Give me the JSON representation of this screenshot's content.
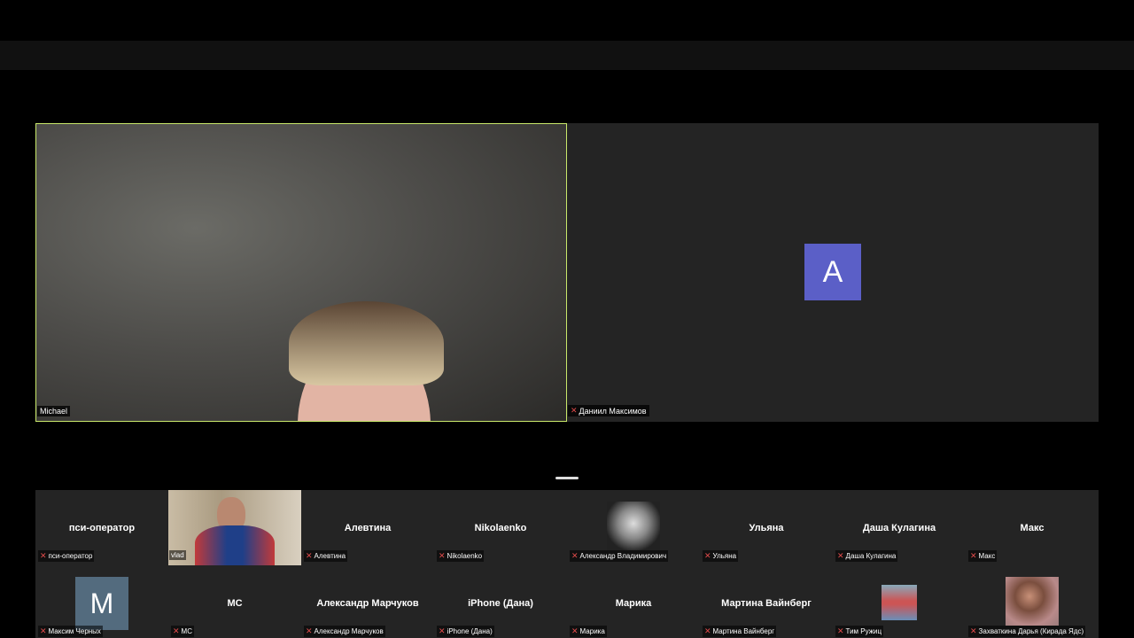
{
  "main_tile": {
    "name": "Michael"
  },
  "right_tile": {
    "avatar_letter": "A",
    "name": "Даниил Максимов"
  },
  "participants": [
    {
      "title": "пси-оператор",
      "label": "пси-оператор"
    },
    {
      "title": "",
      "label": "vlad"
    },
    {
      "title": "Алевтина",
      "label": "Алевтина"
    },
    {
      "title": "Nikolaenko",
      "label": "Nikolaenko"
    },
    {
      "title": "",
      "label": "Александр Владимирович"
    },
    {
      "title": "Ульяна",
      "label": "Ульяна"
    },
    {
      "title": "Даша Кулагина",
      "label": "Даша Кулагина"
    },
    {
      "title": "Макс",
      "label": "Макс"
    },
    {
      "title": "",
      "label": "Максим Черных",
      "avatar_letter": "M"
    },
    {
      "title": "МС",
      "label": "МС"
    },
    {
      "title": "Александр Марчуков",
      "label": "Александр Марчуков"
    },
    {
      "title": "iPhone (Дана)",
      "label": "iPhone (Дана)"
    },
    {
      "title": "Марика",
      "label": "Марика"
    },
    {
      "title": "Мартина Вайнберг",
      "label": "Мартина Вайнберг"
    },
    {
      "title": "",
      "label": "Тим Ружиц"
    },
    {
      "title": "",
      "label": "Захваткина Дарья (Кирада Ядс)"
    }
  ],
  "colors": {
    "active_border": "#c9e86a",
    "avatar_purple": "#5b5fc7",
    "muted_red": "#e24b4b"
  },
  "icons": {
    "mic_muted": "mic-off-icon"
  }
}
